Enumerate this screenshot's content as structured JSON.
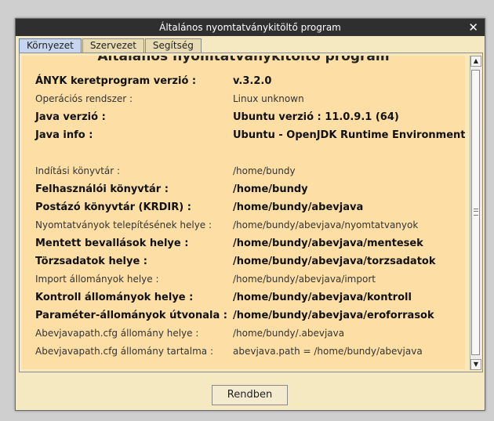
{
  "window": {
    "title": "Általános nyomtatványkitöltő program",
    "close_label": "✕"
  },
  "tabs": [
    {
      "label": "Környezet",
      "active": true
    },
    {
      "label": "Szervezet",
      "active": false
    },
    {
      "label": "Segítség",
      "active": false
    }
  ],
  "content": {
    "heading": "Általános nyomtatványkitöltő program",
    "rows": [
      {
        "label": "ÁNYK keretprogram verzió :",
        "value": "v.3.2.0",
        "bold": true
      },
      {
        "label": "Operációs rendszer :",
        "value": "Linux unknown",
        "bold": false
      },
      {
        "label": "Java verzió :",
        "value": "Ubuntu verzió : 11.0.9.1 (64)",
        "bold": true
      },
      {
        "label": "Java info :",
        "value": "Ubuntu - OpenJDK Runtime Environment",
        "bold": true
      },
      {
        "label": "Indítási könyvtár :",
        "value": "/home/bundy",
        "bold": false
      },
      {
        "label": "Felhasználói könyvtár :",
        "value": "/home/bundy",
        "bold": true
      },
      {
        "label": "Postázó könyvtár (KRDIR) :",
        "value": "/home/bundy/abevjava",
        "bold": true
      },
      {
        "label": "Nyomtatványok telepítésének helye :",
        "value": "/home/bundy/abevjava/nyomtatvanyok",
        "bold": false
      },
      {
        "label": "Mentett bevallások helye :",
        "value": "/home/bundy/abevjava/mentesek",
        "bold": true
      },
      {
        "label": "Törzsadatok helye :",
        "value": "/home/bundy/abevjava/torzsadatok",
        "bold": true
      },
      {
        "label": "Import állományok helye :",
        "value": "/home/bundy/abevjava/import",
        "bold": false
      },
      {
        "label": "Kontroll állományok helye :",
        "value": "/home/bundy/abevjava/kontroll",
        "bold": true
      },
      {
        "label": "Paraméter-állományok útvonala :",
        "value": "/home/bundy/abevjava/eroforrasok",
        "bold": true
      },
      {
        "label": "Abevjavapath.cfg állomány helye :",
        "value": "/home/bundy/.abevjava",
        "bold": false
      },
      {
        "label": "Abevjavapath.cfg állomány tartalma :",
        "value": "abevjava.path = /home/bundy/abevjava",
        "bold": false
      }
    ]
  },
  "footer": {
    "ok_label": "Rendben"
  },
  "colors": {
    "panel_bg": "#fddfa5",
    "window_bg": "#f5e9c2",
    "titlebar_bg": "#2f2f2f",
    "active_tab": "#c7d6ee"
  }
}
